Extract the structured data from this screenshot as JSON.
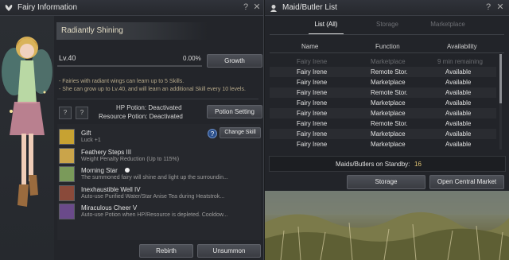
{
  "fairy_window": {
    "title": "Fairy Information",
    "help_label": "?",
    "close_label": "✕",
    "fairy_name": "Radiantly Shining",
    "level": "Lv.40",
    "exp_percent": "0.00%",
    "exp_fraction": 0.0,
    "growth_label": "Growth",
    "notes": [
      "- Fairies with radiant wings can learn up to 5 Skills.",
      "- She can grow up to Lv.40, and will learn an additional Skill every 10 levels."
    ],
    "potion_slot_labels": [
      "?",
      "?"
    ],
    "hp_potion": "HP Potion: Deactivated",
    "resource_potion": "Resource Potion: Deactivated",
    "potion_setting_label": "Potion Setting",
    "skill_help_label": "?",
    "change_skill_label": "Change Skill",
    "skills": [
      {
        "name": "Gift",
        "desc": "Luck +1",
        "color": "#c7a232"
      },
      {
        "name": "Feathery Steps III",
        "desc": "Weight Penalty Reduction (Up to 115%)",
        "color": "#caa44a"
      },
      {
        "name": "Morning Star",
        "desc": "The summoned fairy will shine and light up the surroundin...",
        "color": "#7a9a5a"
      },
      {
        "name": "Inexhaustible Well IV",
        "desc": "Auto-use Purified Water/Star Anise Tea during Heatstrok...",
        "color": "#8a4a3a"
      },
      {
        "name": "Miraculous Cheer V",
        "desc": "Auto-use Potion when HP/Resource is depleted. Cooldow...",
        "color": "#6a4a8a"
      }
    ],
    "rebirth_label": "Rebirth",
    "unsummon_label": "Unsummon"
  },
  "maid_window": {
    "title": "Maid/Butler List",
    "help_label": "?",
    "close_label": "✕",
    "tabs": [
      "List (All)",
      "Storage",
      "Marketplace"
    ],
    "columns": [
      "Name",
      "Function",
      "Availability"
    ],
    "rows": [
      {
        "name": "Fairy Irene",
        "function": "Marketplace",
        "availability": "9 min remaining"
      },
      {
        "name": "Fairy Irene",
        "function": "Remote Stor.",
        "availability": "Available"
      },
      {
        "name": "Fairy Irene",
        "function": "Marketplace",
        "availability": "Available"
      },
      {
        "name": "Fairy Irene",
        "function": "Remote Stor.",
        "availability": "Available"
      },
      {
        "name": "Fairy Irene",
        "function": "Marketplace",
        "availability": "Available"
      },
      {
        "name": "Fairy Irene",
        "function": "Marketplace",
        "availability": "Available"
      },
      {
        "name": "Fairy Irene",
        "function": "Remote Stor.",
        "availability": "Available"
      },
      {
        "name": "Fairy Irene",
        "function": "Marketplace",
        "availability": "Available"
      },
      {
        "name": "Fairy Irene",
        "function": "Marketplace",
        "availability": "Available"
      }
    ],
    "standby_label": "Maids/Butlers on Standby:",
    "standby_count": "16",
    "storage_label": "Storage",
    "central_market_label": "Open Central Market"
  }
}
